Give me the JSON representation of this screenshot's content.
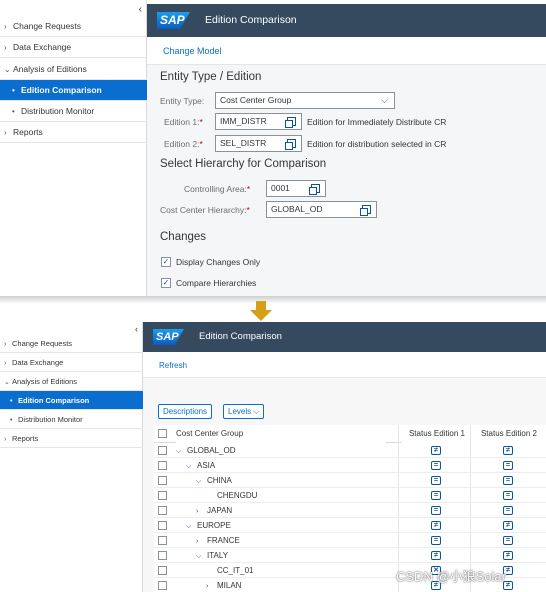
{
  "panel1": {
    "nav": {
      "collapse_glyph": "‹",
      "items": [
        {
          "label": "Change Requests",
          "arrow": "›"
        },
        {
          "label": "Data Exchange",
          "arrow": "›"
        },
        {
          "label": "Analysis of Editions",
          "arrow": "⌄"
        },
        {
          "label": "Edition Comparison",
          "arrow": "•"
        },
        {
          "label": "Distribution Monitor",
          "arrow": "•"
        },
        {
          "label": "Reports",
          "arrow": "›"
        }
      ]
    },
    "shell": {
      "logo": "SAP",
      "title": "Edition Comparison"
    },
    "toolbar": {
      "change_model": "Change Model"
    },
    "form": {
      "entity_section_title": "Entity Type / Edition",
      "entity_type_label": "Entity Type:",
      "entity_type_value": "Cost Center Group",
      "edition1_label": "Edition 1:",
      "edition1_value": "IMM_DISTR",
      "edition1_desc": "Edition for Immediately Distribute CR",
      "edition2_label": "Edition 2:",
      "edition2_value": "SEL_DISTR",
      "edition2_desc": "Edition for distribution selected in CR",
      "hierarchy_section_title": "Select Hierarchy for Comparison",
      "controlling_area_label": "Controlling Area:",
      "controlling_area_value": "0001",
      "cc_hierarchy_label": "Cost Center Hierarchy:",
      "cc_hierarchy_value": "GLOBAL_OD",
      "required_marker": "*",
      "changes_section_title": "Changes",
      "display_changes_only": "Display Changes Only",
      "compare_hierarchies": "Compare Hierarchies",
      "check_glyph": "✓"
    }
  },
  "panel2": {
    "nav": {
      "collapse_glyph": "‹",
      "items": [
        {
          "label": "Change Requests",
          "arrow": "›"
        },
        {
          "label": "Data Exchange",
          "arrow": "›"
        },
        {
          "label": "Analysis of Editions",
          "arrow": "⌄"
        },
        {
          "label": "Edition Comparison",
          "arrow": "•"
        },
        {
          "label": "Distribution Monitor",
          "arrow": "•"
        },
        {
          "label": "Reports",
          "arrow": "›"
        }
      ]
    },
    "shell": {
      "logo": "SAP",
      "title": "Edition Comparison"
    },
    "toolbar": {
      "refresh": "Refresh"
    },
    "buttons": {
      "descriptions": "Descriptions",
      "levels": "Levels ⌵"
    },
    "table": {
      "columns": [
        "Cost Center Group",
        "Status Edition 1",
        "Status Edition 2"
      ],
      "rows": [
        {
          "node": "GLOBAL_OD",
          "toggle": "⌵",
          "s1": "≠",
          "s2": "≠"
        },
        {
          "node": "ASIA",
          "toggle": "⌵",
          "s1": "=",
          "s2": "="
        },
        {
          "node": "CHINA",
          "toggle": "⌵",
          "s1": "=",
          "s2": "="
        },
        {
          "node": "CHENGDU",
          "toggle": "",
          "s1": "=",
          "s2": "="
        },
        {
          "node": "JAPAN",
          "toggle": "›",
          "s1": "=",
          "s2": "="
        },
        {
          "node": "EUROPE",
          "toggle": "⌵",
          "s1": "≠",
          "s2": "≠"
        },
        {
          "node": "FRANCE",
          "toggle": "›",
          "s1": "=",
          "s2": "="
        },
        {
          "node": "ITALY",
          "toggle": "⌵",
          "s1": "≠",
          "s2": "≠"
        },
        {
          "node": "CC_IT_01",
          "toggle": "",
          "s1": "✕",
          "s2": "≠"
        },
        {
          "node": "MILAN",
          "toggle": "›",
          "s1": "≠",
          "s2": "≠"
        }
      ]
    }
  },
  "watermark": "CSDN @小狼Solar",
  "colors": {
    "shell_bg": "#354a5f",
    "selected_nav": "#0a6ed1",
    "link": "#0a6ed1",
    "required": "#bb0000",
    "arrow": "#d4a017"
  }
}
